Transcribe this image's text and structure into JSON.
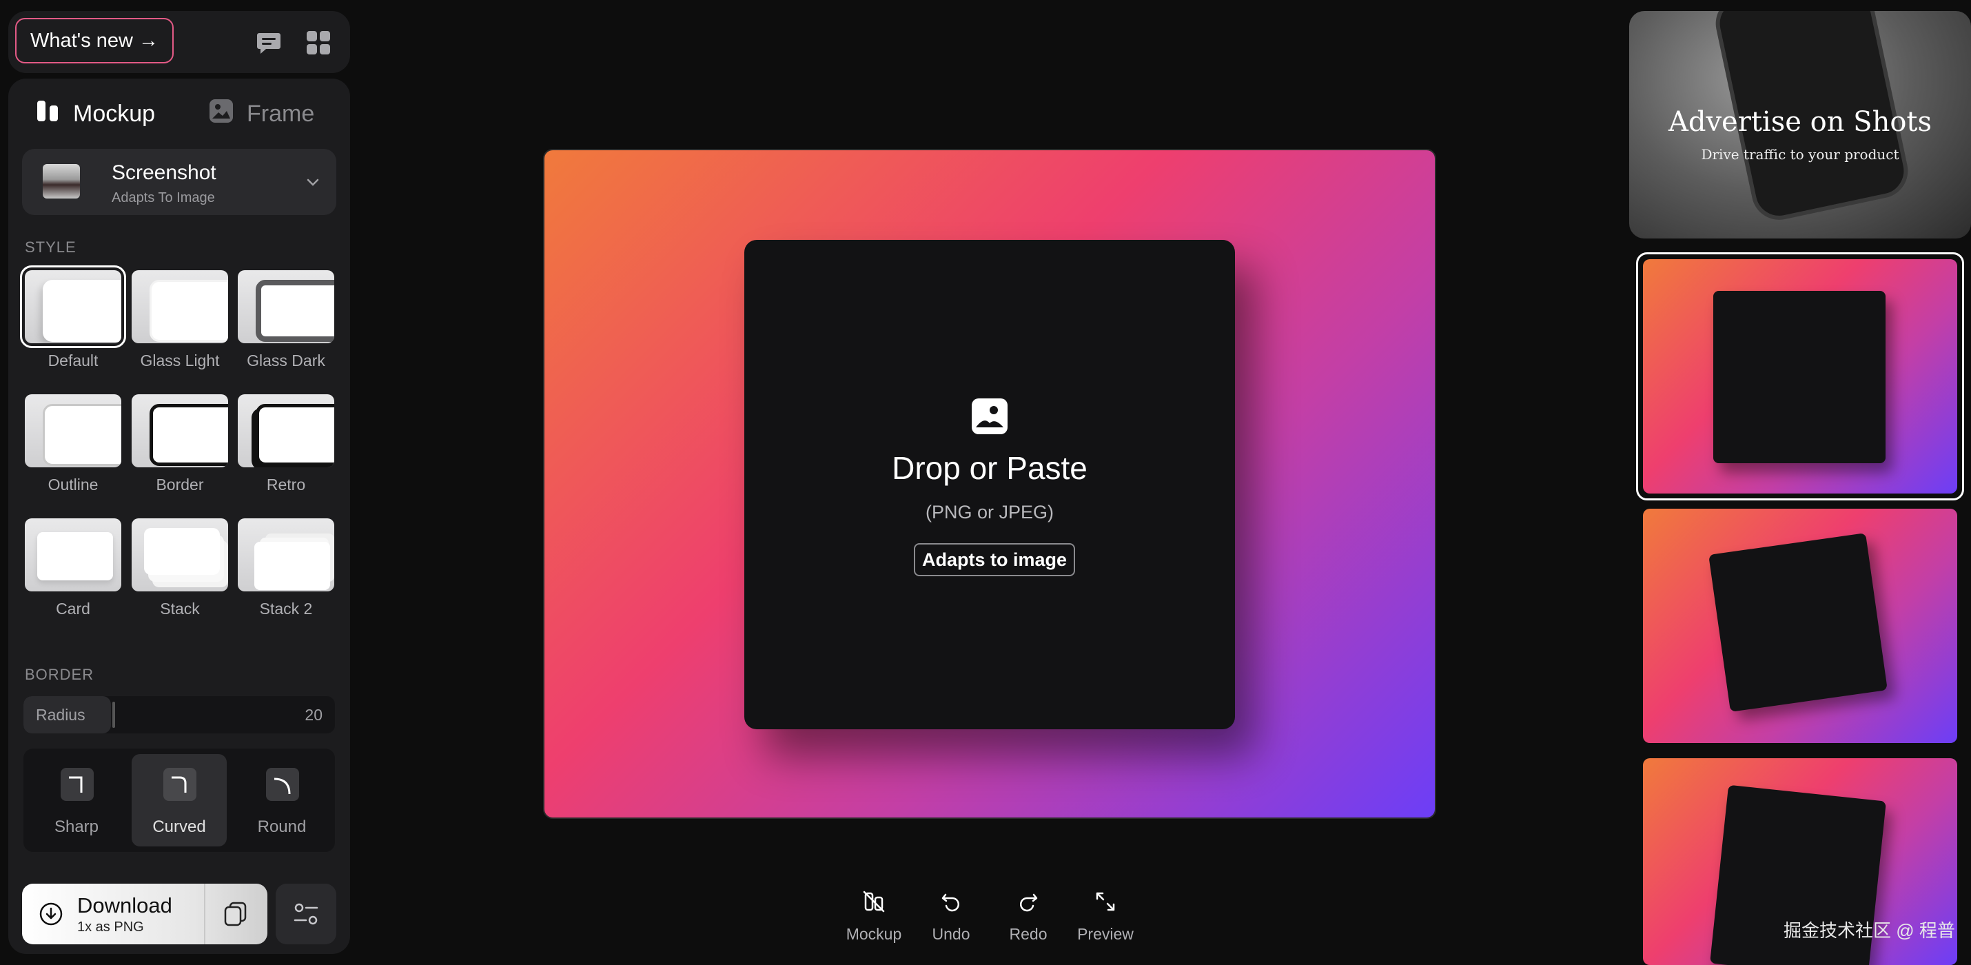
{
  "topbar": {
    "whats_new": "What's new →"
  },
  "tabs": [
    {
      "label": "Mockup",
      "active": true
    },
    {
      "label": "Frame",
      "active": false
    }
  ],
  "selector": {
    "title": "Screenshot",
    "subtitle": "Adapts To Image"
  },
  "style_section": {
    "label": "STYLE",
    "options": [
      {
        "name": "Default",
        "selected": true
      },
      {
        "name": "Glass Light",
        "selected": false
      },
      {
        "name": "Glass Dark",
        "selected": false
      },
      {
        "name": "Outline",
        "selected": false
      },
      {
        "name": "Border",
        "selected": false
      },
      {
        "name": "Retro",
        "selected": false
      },
      {
        "name": "Card",
        "selected": false
      },
      {
        "name": "Stack",
        "selected": false
      },
      {
        "name": "Stack 2",
        "selected": false
      }
    ]
  },
  "border_section": {
    "label": "BORDER",
    "radius_label": "Radius",
    "radius_value": "20",
    "radius_fraction": 0.28,
    "corner_options": [
      {
        "name": "Sharp",
        "active": false
      },
      {
        "name": "Curved",
        "active": true
      },
      {
        "name": "Round",
        "active": false
      }
    ]
  },
  "download": {
    "title": "Download",
    "subtitle": "1x as PNG"
  },
  "canvas": {
    "drop_title": "Drop or Paste",
    "drop_subtitle": "(PNG or JPEG)",
    "adapt_badge": "Adapts to image"
  },
  "toolbar": [
    {
      "label": "Mockup",
      "icon": "mockup-off-icon"
    },
    {
      "label": "Undo",
      "icon": "undo-icon"
    },
    {
      "label": "Redo",
      "icon": "redo-icon"
    },
    {
      "label": "Preview",
      "icon": "expand-icon"
    }
  ],
  "ad": {
    "title": "Advertise on Shots",
    "subtitle": "Drive traffic to your product"
  },
  "watermark": "掘金技术社区 @ 程普",
  "colors": {
    "accent_border": "#e35a86",
    "gradient_start": "#f07a3c",
    "gradient_mid": "#ee3f6e",
    "gradient_end": "#6c3ef7"
  }
}
